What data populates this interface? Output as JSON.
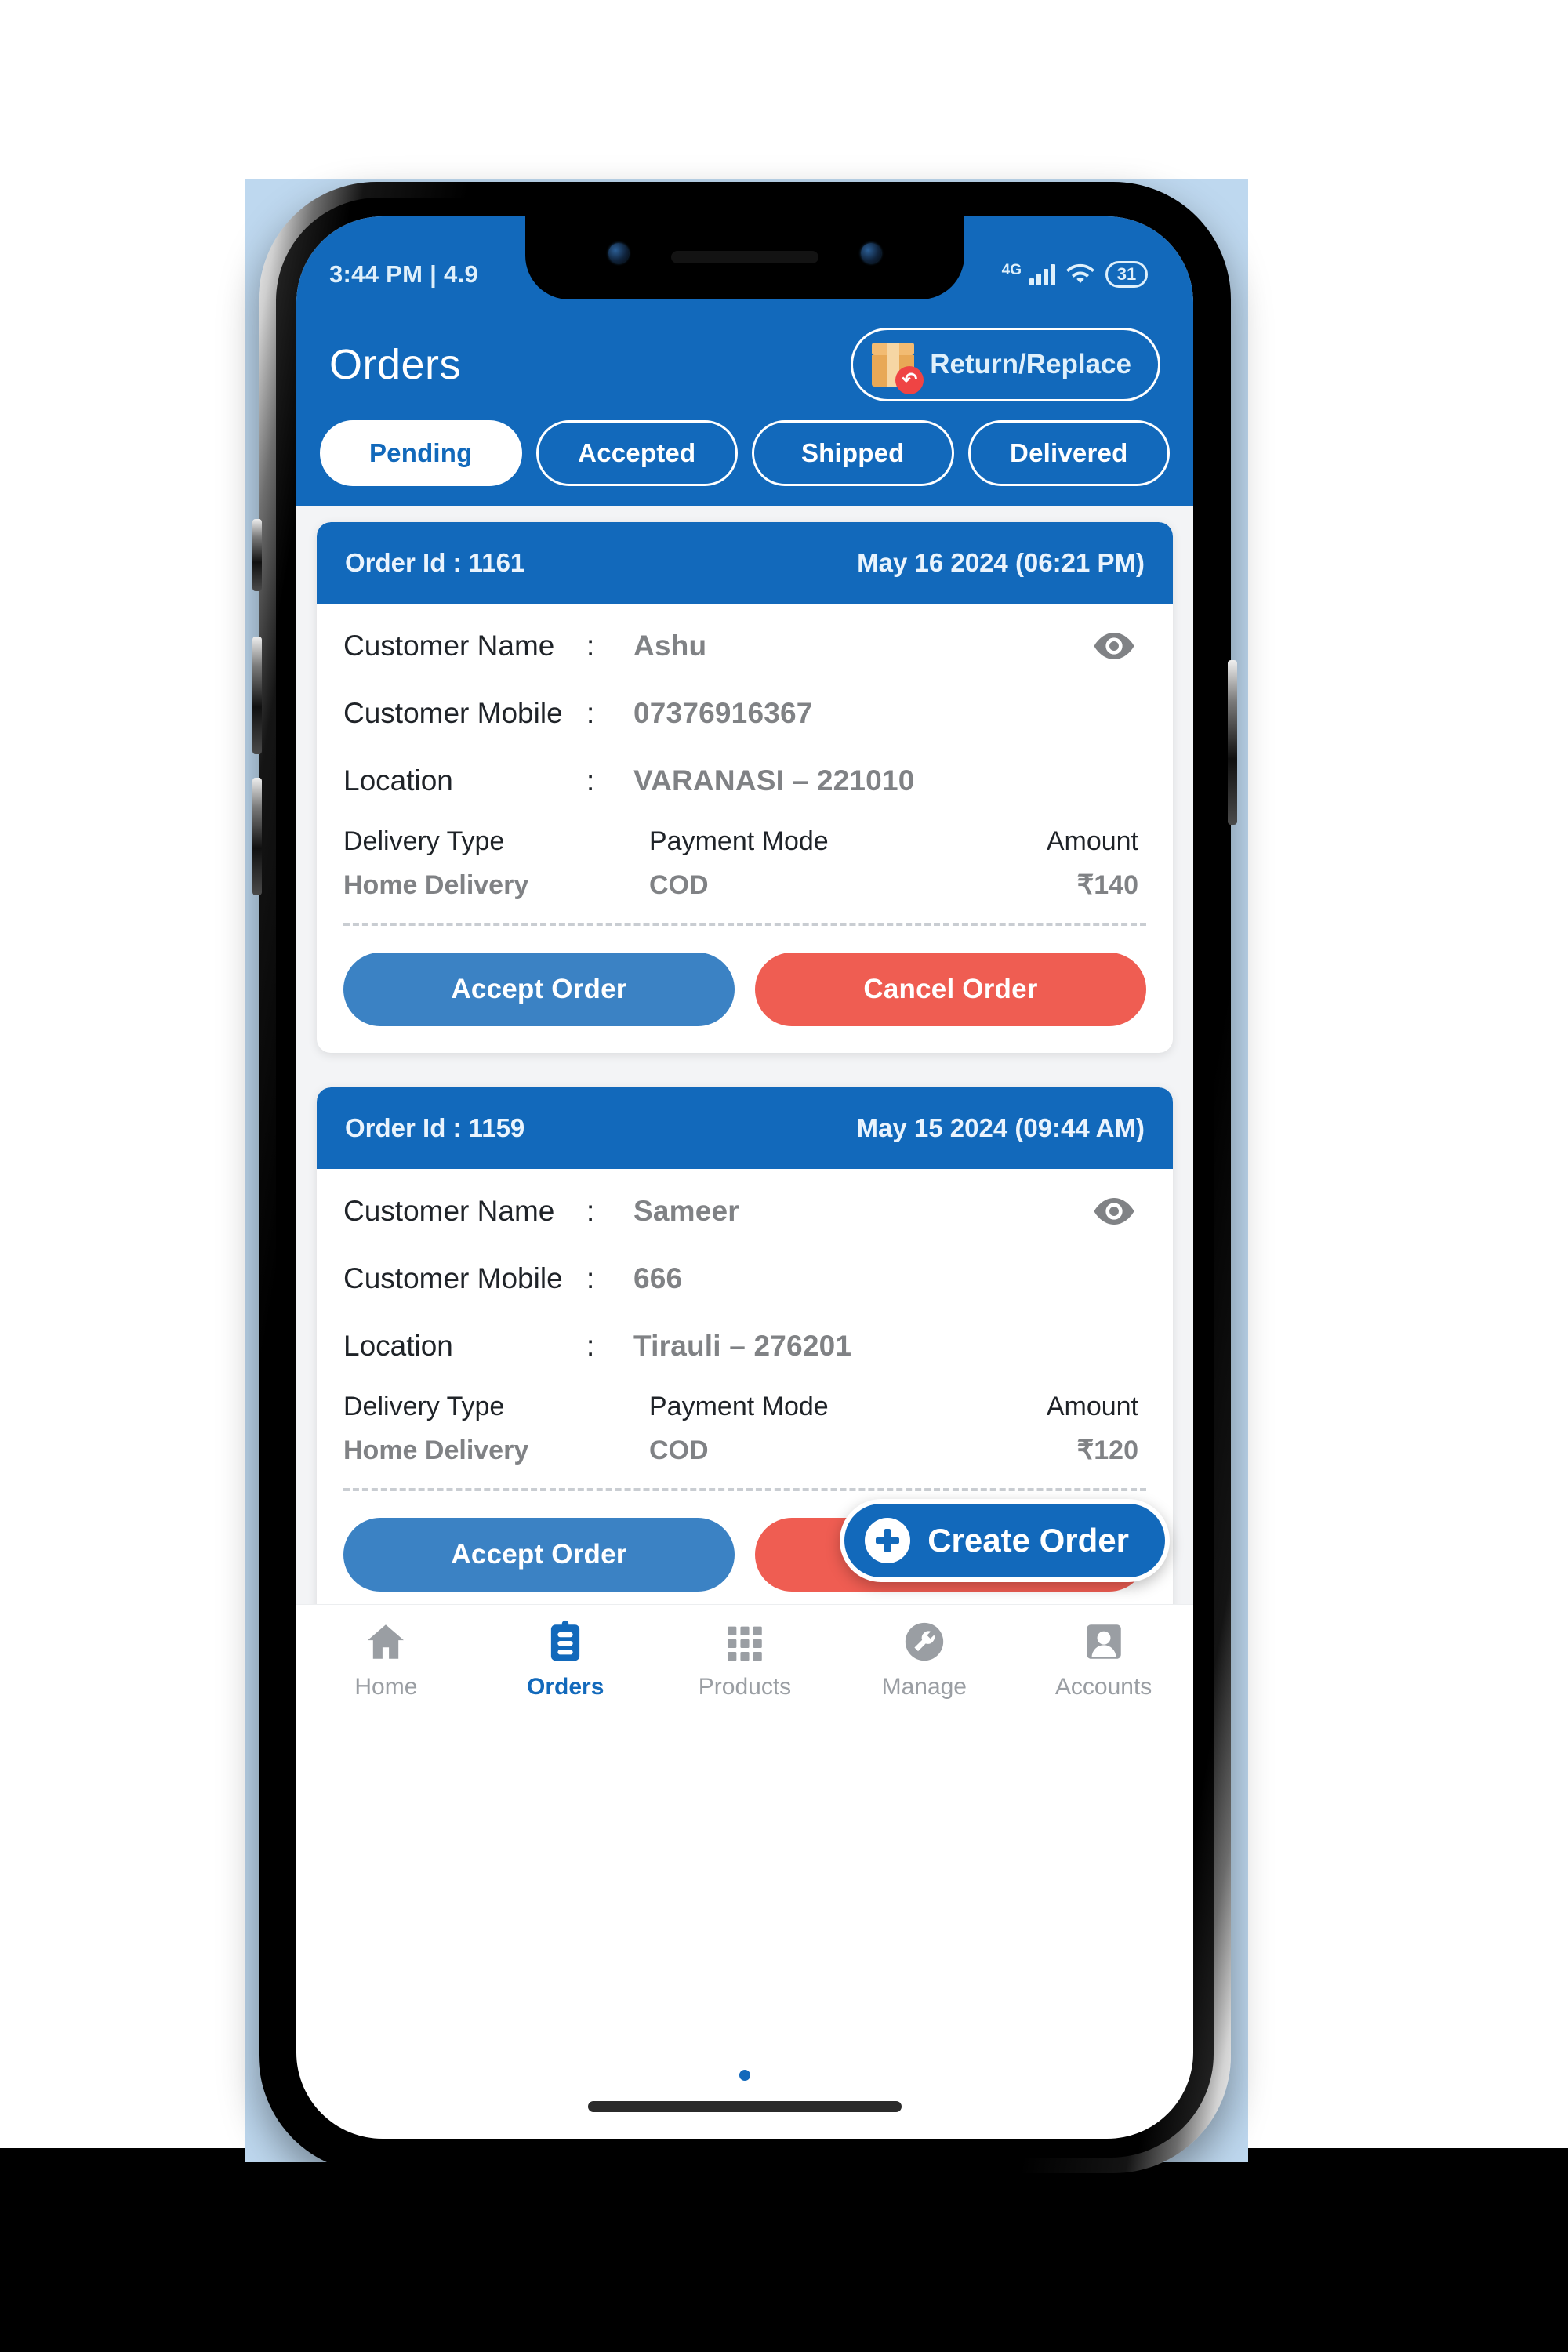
{
  "statusbar": {
    "time_text": "3:44 PM | 4.9",
    "network_label": "4G",
    "battery_level": "31"
  },
  "header": {
    "title": "Orders",
    "return_replace_label": "Return/Replace",
    "return_icon": "package-return-icon"
  },
  "tabs": [
    {
      "label": "Pending",
      "active": true
    },
    {
      "label": "Accepted",
      "active": false
    },
    {
      "label": "Shipped",
      "active": false
    },
    {
      "label": "Delivered",
      "active": false
    }
  ],
  "labels": {
    "order_id_prefix": "Order Id : ",
    "customer_name": "Customer Name",
    "customer_mobile": "Customer Mobile",
    "location": "Location",
    "colon": ":",
    "delivery_type": "Delivery Type",
    "payment_mode": "Payment Mode",
    "amount": "Amount",
    "accept": "Accept Order",
    "cancel": "Cancel Order"
  },
  "orders": [
    {
      "order_id": "Order Id : 1161",
      "date": "May 16 2024 (06:21 PM)",
      "customer_name": "Ashu",
      "customer_mobile": "07376916367",
      "location": "VARANASI – 221010",
      "delivery_type": "Home Delivery",
      "payment_mode": "COD",
      "amount": "₹140"
    },
    {
      "order_id": "Order Id : 1159",
      "date": "May 15 2024 (09:44 AM)",
      "customer_name": "Sameer",
      "customer_mobile": "666",
      "location": "Tirauli – 276201",
      "delivery_type": "Home Delivery",
      "payment_mode": "COD",
      "amount": "₹120"
    }
  ],
  "fab": {
    "label": "Create Order",
    "icon": "plus-circle-icon"
  },
  "bottom_nav": [
    {
      "label": "Home",
      "icon": "home-icon",
      "active": false
    },
    {
      "label": "Orders",
      "icon": "clipboard-icon",
      "active": true
    },
    {
      "label": "Products",
      "icon": "grid-icon",
      "active": false
    },
    {
      "label": "Manage",
      "icon": "wrench-icon",
      "active": false
    },
    {
      "label": "Accounts",
      "icon": "person-icon",
      "active": false
    }
  ],
  "colors": {
    "brand_blue": "#1269bb",
    "accept_blue": "#3b82c4",
    "cancel_red": "#ef5d52",
    "backdrop": "#bed8ef",
    "value_gray": "#808285"
  }
}
